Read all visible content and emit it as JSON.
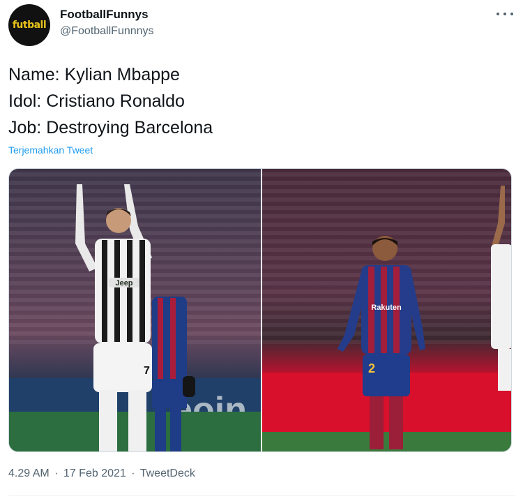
{
  "author": {
    "avatar_text": "futball",
    "name": "FootballFunnys",
    "handle": "@FootballFunnnys"
  },
  "tweet": {
    "lines": [
      "Name: Kylian Mbappe",
      "Idol: Cristiano Ronaldo",
      "Job: Destroying Barcelona"
    ],
    "translate_label": "Terjemahkan Tweet"
  },
  "media": {
    "left_photo": {
      "ad_text": "eoin",
      "player_number": "7",
      "player_sponsor": "Jeep"
    },
    "right_photo": {
      "player_number": "2",
      "player_sponsor": "Rakuten"
    }
  },
  "footer": {
    "time": "4.29 AM",
    "separator": "·",
    "date": "17 Feb 2021",
    "source": "TweetDeck"
  }
}
